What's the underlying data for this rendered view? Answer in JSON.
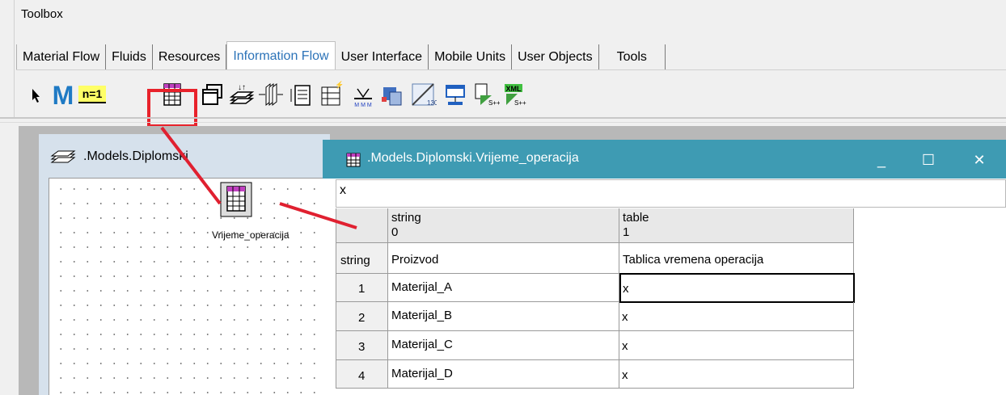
{
  "toolbox": {
    "title": "Toolbox"
  },
  "tabs": [
    {
      "label": "Material Flow"
    },
    {
      "label": "Fluids"
    },
    {
      "label": "Resources"
    },
    {
      "label": "Information Flow",
      "active": true
    },
    {
      "label": "User Interface"
    },
    {
      "label": "Mobile Units"
    },
    {
      "label": "User Objects"
    },
    {
      "label": "Tools"
    }
  ],
  "toolbar_icons": [
    "pointer-icon",
    "method-icon",
    "variable-icon",
    "table-file-icon",
    "dialog-icon",
    "stack-file-icon",
    "queue-file-icon",
    "card-file-icon",
    "time-sequence-icon",
    "trigger-icon",
    "generator-icon",
    "interface-icon",
    "socket-icon",
    "sql-lite-icon",
    "xml-icon"
  ],
  "variable_label": "n=1",
  "model_window": {
    "title": ".Models.Diplomski",
    "object_label": "Vrijeme_operacija"
  },
  "table_window": {
    "title": ".Models.Diplomski.Vrijeme_operacija",
    "minimize": "_",
    "maximize": "☐",
    "close": "✕",
    "formula_value": "x",
    "columns": [
      {
        "type": "string",
        "index": "0"
      },
      {
        "type": "table",
        "index": "1"
      }
    ],
    "header_row": {
      "row_label": "string",
      "col0": "Proizvod",
      "col1": "Tablica vremena operacija"
    },
    "rows": [
      {
        "index": "1",
        "col0": "Materijal_A",
        "col1": "x"
      },
      {
        "index": "2",
        "col0": "Materijal_B",
        "col1": "x"
      },
      {
        "index": "3",
        "col0": "Materijal_C",
        "col1": "x"
      },
      {
        "index": "4",
        "col0": "Materijal_D",
        "col1": "x"
      }
    ]
  },
  "colors": {
    "highlight": "#e8222b",
    "title_bar": "#3e9bb3",
    "active_tab_text": "#2c73b8",
    "annotation_line": "#e02030"
  }
}
